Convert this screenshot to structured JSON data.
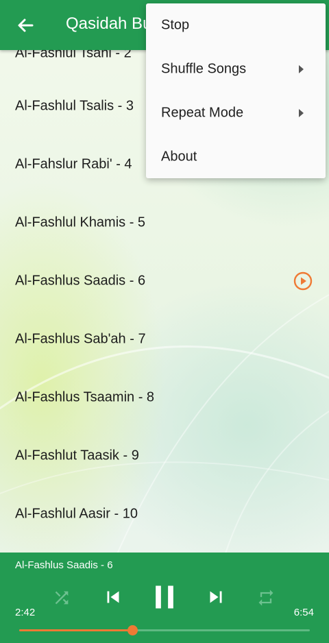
{
  "app_bar": {
    "title": "Qasidah Burdah",
    "back_icon": "arrow-back-icon"
  },
  "tracks": [
    {
      "title": "Al-Fashlul Tsani - 2",
      "playing": false
    },
    {
      "title": "Al-Fashlul Tsalis - 3",
      "playing": false
    },
    {
      "title": "Al-Fahslur Rabi' - 4",
      "playing": false
    },
    {
      "title": "Al-Fashlul Khamis - 5",
      "playing": false
    },
    {
      "title": "Al-Fashlus Saadis - 6",
      "playing": true
    },
    {
      "title": "Al-Fashlus Sab'ah - 7",
      "playing": false
    },
    {
      "title": "Al-Fashlus Tsaamin - 8",
      "playing": false
    },
    {
      "title": "Al-Fashlut Taasik - 9",
      "playing": false
    },
    {
      "title": "Al-Fashlul Aasir - 10",
      "playing": false
    }
  ],
  "overflow_menu": {
    "items": [
      {
        "label": "Stop",
        "has_submenu": false
      },
      {
        "label": "Shuffle Songs",
        "has_submenu": true
      },
      {
        "label": "Repeat Mode",
        "has_submenu": true
      },
      {
        "label": "About",
        "has_submenu": false
      }
    ]
  },
  "player": {
    "now_playing": "Al-Fashlus Saadis - 6",
    "elapsed": "2:42",
    "total": "6:54",
    "progress": 0.39,
    "shuffle_enabled": false,
    "repeat_enabled": false,
    "icons": {
      "shuffle": "shuffle-icon",
      "previous": "skip-previous-icon",
      "play_pause": "pause-icon",
      "next": "skip-next-icon",
      "repeat": "repeat-icon"
    }
  },
  "colors": {
    "primary": "#239b52",
    "accent": "#ef7a34",
    "menu_background": "#fafafa",
    "text": "#1c1c1c"
  }
}
